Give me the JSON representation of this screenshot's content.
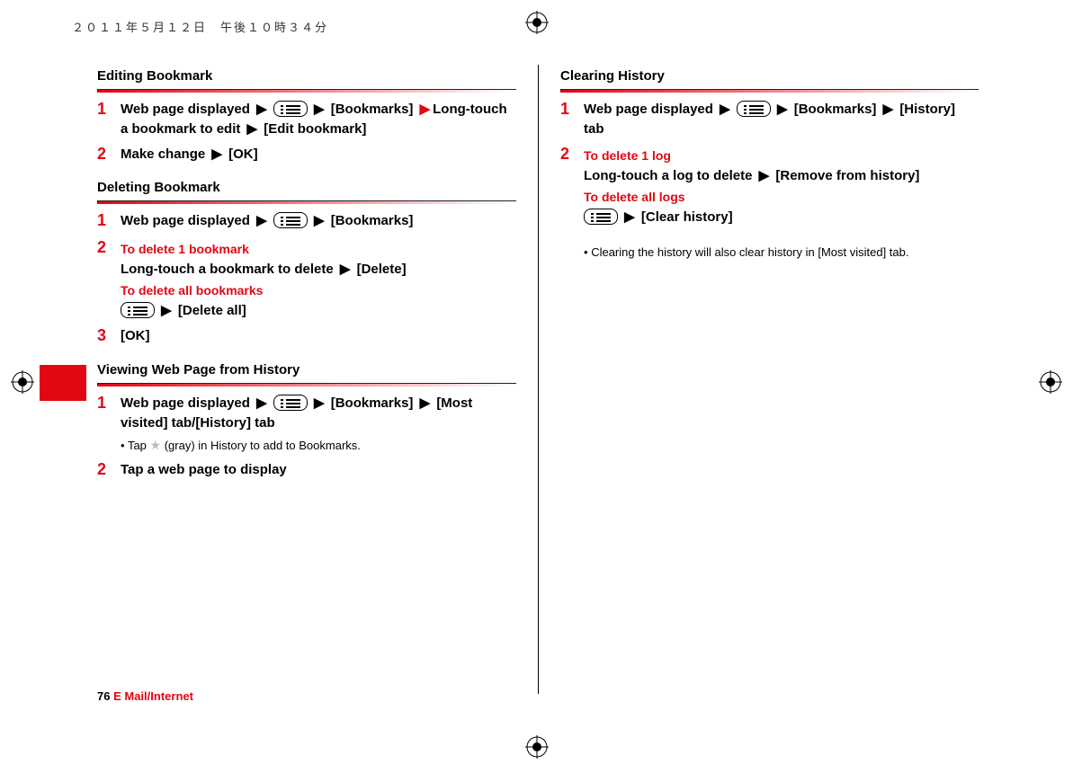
{
  "timestamp": "２０１１年５月１２日　午後１０時３４分",
  "left": {
    "s1": {
      "title": "Editing Bookmark",
      "step1": {
        "a": "Web page displayed",
        "b": "[Bookmarks]",
        "c": "Long-touch a bookmark to edit",
        "d": "[Edit bookmark]"
      },
      "step2": {
        "a": "Make change",
        "b": "[OK]"
      }
    },
    "s2": {
      "title": "Deleting Bookmark",
      "step1": {
        "a": "Web page displayed",
        "b": "[Bookmarks]"
      },
      "step2": {
        "sub1": "To delete 1 bookmark",
        "a": "Long-touch a bookmark to delete",
        "b": "[Delete]",
        "sub2": "To delete all bookmarks",
        "c": "[Delete all]"
      },
      "step3": {
        "a": "[OK]"
      }
    },
    "s3": {
      "title": "Viewing Web Page from History",
      "step1": {
        "a": "Web page displayed",
        "b": "[Bookmarks]",
        "c": "[Most visited] tab/[History] tab",
        "note_a": "Tap ",
        "note_b": " (gray) in History to add to Bookmarks."
      },
      "step2": {
        "a": "Tap a web page to display"
      }
    }
  },
  "right": {
    "s1": {
      "title": "Clearing History",
      "step1": {
        "a": "Web page displayed",
        "b": "[Bookmarks]",
        "c": "[History] tab"
      },
      "step2": {
        "sub1": "To delete 1 log",
        "a": "Long-touch a log to delete",
        "b": "[Remove from history]",
        "sub2": "To delete all logs",
        "c": "[Clear history]"
      },
      "note": "Clearing the history will also clear history in [Most visited] tab."
    }
  },
  "footer": {
    "page": "76",
    "section": "E Mail/Internet"
  }
}
